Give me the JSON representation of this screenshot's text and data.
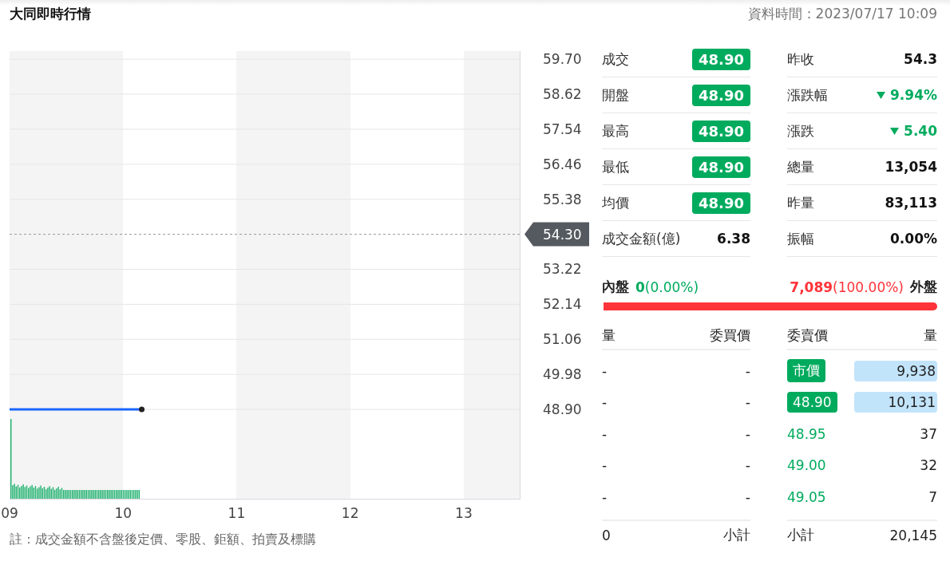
{
  "header": {
    "title": "大同即時行情",
    "data_time": "資料時間：2023/07/17 10:09"
  },
  "chart": {
    "chart_data": {
      "type": "line",
      "x": [
        9,
        10.15
      ],
      "series": [
        {
          "color": "#1a66ff",
          "values": [
            48.9,
            48.9
          ]
        }
      ],
      "xlim": [
        9,
        13.5
      ],
      "ylim": [
        46.12,
        59.95
      ],
      "grid": true,
      "xticks": [
        {
          "value": 9,
          "label": "09"
        },
        {
          "value": 10,
          "label": "10"
        },
        {
          "value": 11,
          "label": "11"
        },
        {
          "value": 12,
          "label": "12"
        },
        {
          "value": 13,
          "label": "13"
        }
      ],
      "yticks": [
        {
          "value": 59.7,
          "label": "59.70"
        },
        {
          "value": 58.62,
          "label": "58.62"
        },
        {
          "value": 57.54,
          "label": "57.54"
        },
        {
          "value": 56.46,
          "label": "56.46"
        },
        {
          "value": 55.38,
          "label": "55.38"
        },
        {
          "value": 53.22,
          "label": "53.22"
        },
        {
          "value": 52.14,
          "label": "52.14"
        },
        {
          "value": 51.06,
          "label": "51.06"
        },
        {
          "value": 49.98,
          "label": "49.98"
        },
        {
          "value": 48.9,
          "label": "48.90"
        }
      ]
    },
    "reference_price": "54.30"
  },
  "note": "註：成交金額不含盤後定價、零股、鉅額、拍賣及標購",
  "stats_left": [
    {
      "label": "成交",
      "value": "48.90",
      "kind": "badge"
    },
    {
      "label": "開盤",
      "value": "48.90",
      "kind": "badge"
    },
    {
      "label": "最高",
      "value": "48.90",
      "kind": "badge"
    },
    {
      "label": "最低",
      "value": "48.90",
      "kind": "badge"
    },
    {
      "label": "均價",
      "value": "48.90",
      "kind": "badge"
    },
    {
      "label": "成交金額(億)",
      "value": "6.38",
      "kind": "plain"
    }
  ],
  "stats_right": [
    {
      "label": "昨收",
      "value": "54.3",
      "down": false
    },
    {
      "label": "漲跌幅",
      "value": "9.94%",
      "down": true
    },
    {
      "label": "漲跌",
      "value": "5.40",
      "down": true
    },
    {
      "label": "總量",
      "value": "13,054",
      "down": false
    },
    {
      "label": "昨量",
      "value": "83,113",
      "down": false
    },
    {
      "label": "振幅",
      "value": "0.00%",
      "down": false
    }
  ],
  "trade_ratio": {
    "inner_label": "內盤",
    "inner_value": "**0**(0.00%)",
    "outer_value": "**7,089**(100.00%)",
    "outer_label": "外盤",
    "level": 1
  },
  "order_book": {
    "columns": [
      "量",
      "委買價",
      "委賣價",
      "量"
    ],
    "bids": [
      {
        "volume": "-",
        "price": "-"
      },
      {
        "volume": "-",
        "price": "-"
      },
      {
        "volume": "-",
        "price": "-"
      },
      {
        "volume": "-",
        "price": "-"
      },
      {
        "volume": "-",
        "price": "-"
      }
    ],
    "asks": [
      {
        "price": "市價",
        "volume": "9,938",
        "highlighted": true
      },
      {
        "price": "48.90",
        "volume": "10,131",
        "highlighted": true
      },
      {
        "price": "48.95",
        "volume": "37",
        "highlighted": false
      },
      {
        "price": "49.00",
        "volume": "32",
        "highlighted": false
      },
      {
        "price": "49.05",
        "volume": "7",
        "highlighted": false
      }
    ],
    "bid_subtotal": {
      "value": "0",
      "label": "小計"
    },
    "ask_subtotal": {
      "label": "小計",
      "value": "20,145"
    }
  }
}
